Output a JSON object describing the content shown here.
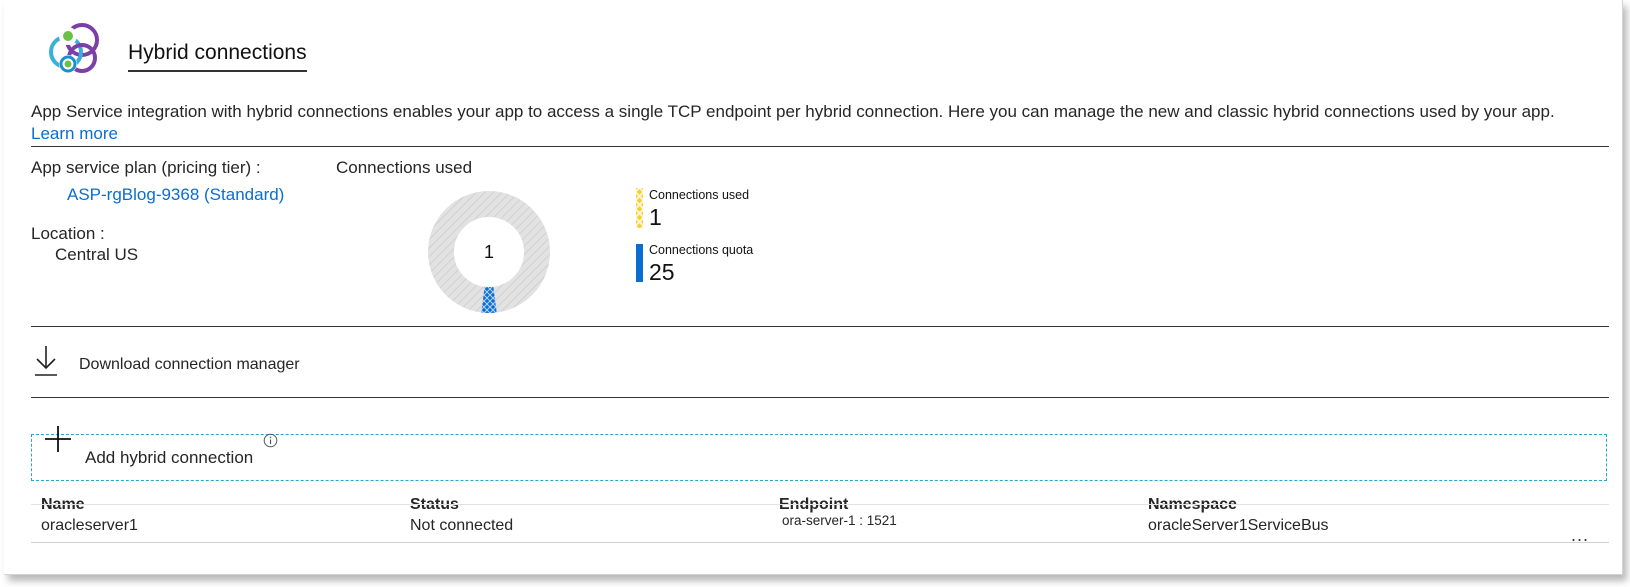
{
  "header": {
    "icon": "hybrid-connections-icon",
    "title": "Hybrid connections"
  },
  "description": "App Service integration with hybrid connections enables your app to access a single TCP endpoint per hybrid connection. Here you can manage the new and classic hybrid connections used by your app.",
  "learn_more": "Learn more",
  "plan": {
    "label": "App service plan (pricing tier) :",
    "value": "ASP-rgBlog-9368 (Standard)"
  },
  "location": {
    "label": "Location :",
    "value": "Central US"
  },
  "connections_used_title": "Connections used",
  "donut": {
    "center_label": "1",
    "used": 1,
    "quota": 25,
    "colors": {
      "used": "#0a6ed1",
      "remaining": "#dcdcdc",
      "used_legend": "#f7cf2e"
    }
  },
  "legend": [
    {
      "name": "Connections used",
      "value": "1"
    },
    {
      "name": "Connections quota",
      "value": "25"
    }
  ],
  "download": {
    "icon": "download-icon",
    "label": "Download connection manager"
  },
  "add": {
    "icon": "plus-icon",
    "label": "Add hybrid connection",
    "info_icon": "info-icon"
  },
  "table": {
    "columns": [
      "Name",
      "Status",
      "Endpoint",
      "Namespace"
    ],
    "rows": [
      {
        "name": "oracleserver1",
        "status": "Not connected",
        "endpoint": "ora-server-1 : 1521",
        "namespace": "oracleServer1ServiceBus",
        "more": "..."
      }
    ]
  },
  "accent_color": "#0a6ed1"
}
